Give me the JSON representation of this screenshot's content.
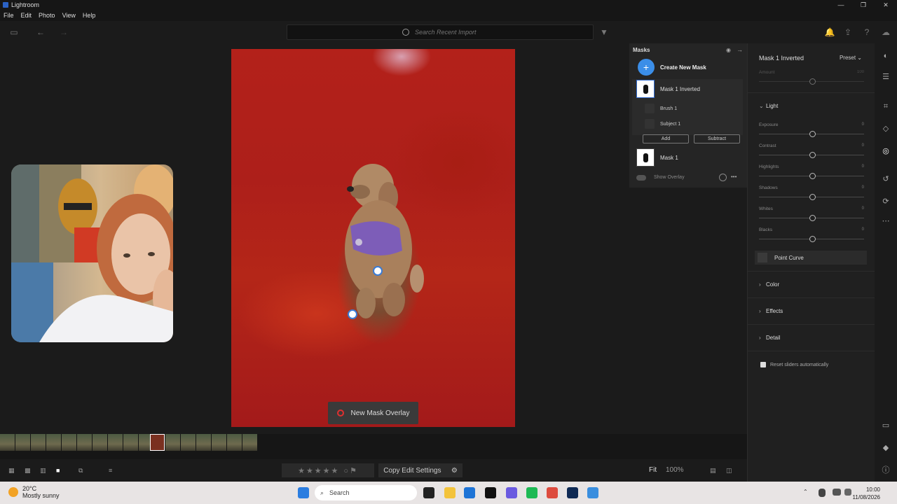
{
  "app": {
    "title": "Lightroom"
  },
  "window": {
    "minimize": "—",
    "maximize": "❐",
    "close": "✕"
  },
  "menu": [
    "File",
    "Edit",
    "Photo",
    "View",
    "Help"
  ],
  "search": {
    "placeholder": "Search Recent Import"
  },
  "canvas": {
    "overlay_button": "New Mask Overlay"
  },
  "masks": {
    "header": "Masks",
    "create_label": "Create New Mask",
    "create_icon": "+",
    "items": [
      {
        "name": "Mask 1 Inverted"
      },
      {
        "name": "Mask 1"
      }
    ],
    "sub_items": [
      "Brush 1",
      "Subject 1"
    ],
    "add_label": "Add",
    "subtract_label": "Subtract",
    "show_overlay": "Show Overlay",
    "more": "•••"
  },
  "right_panel": {
    "title": "Mask 1 Inverted",
    "preset": "Preset",
    "amount": {
      "label": "Amount",
      "value": "100"
    },
    "light_section": "Light",
    "sliders": [
      {
        "label": "Exposure",
        "value": "0"
      },
      {
        "label": "Contrast",
        "value": "0"
      },
      {
        "label": "Highlights",
        "value": "0"
      },
      {
        "label": "Shadows",
        "value": "0"
      },
      {
        "label": "Whites",
        "value": "0"
      },
      {
        "label": "Blacks",
        "value": "0"
      }
    ],
    "point_curve": "Point Curve",
    "sections": [
      "Color",
      "Effects",
      "Detail"
    ],
    "reset_label": "Reset sliders automatically"
  },
  "bottombar": {
    "stars": "★★★★★",
    "copy_edit": "Copy Edit Settings",
    "fit": "Fit",
    "zoom": "100%"
  },
  "taskbar": {
    "temp": "20°C",
    "weather": "Mostly sunny",
    "search": "Search",
    "time": "10:00",
    "date": "11/08/2026"
  },
  "colors": {
    "accent": "#3b8ee8",
    "mask_overlay": "#b3211a",
    "panel_bg": "#202020"
  }
}
